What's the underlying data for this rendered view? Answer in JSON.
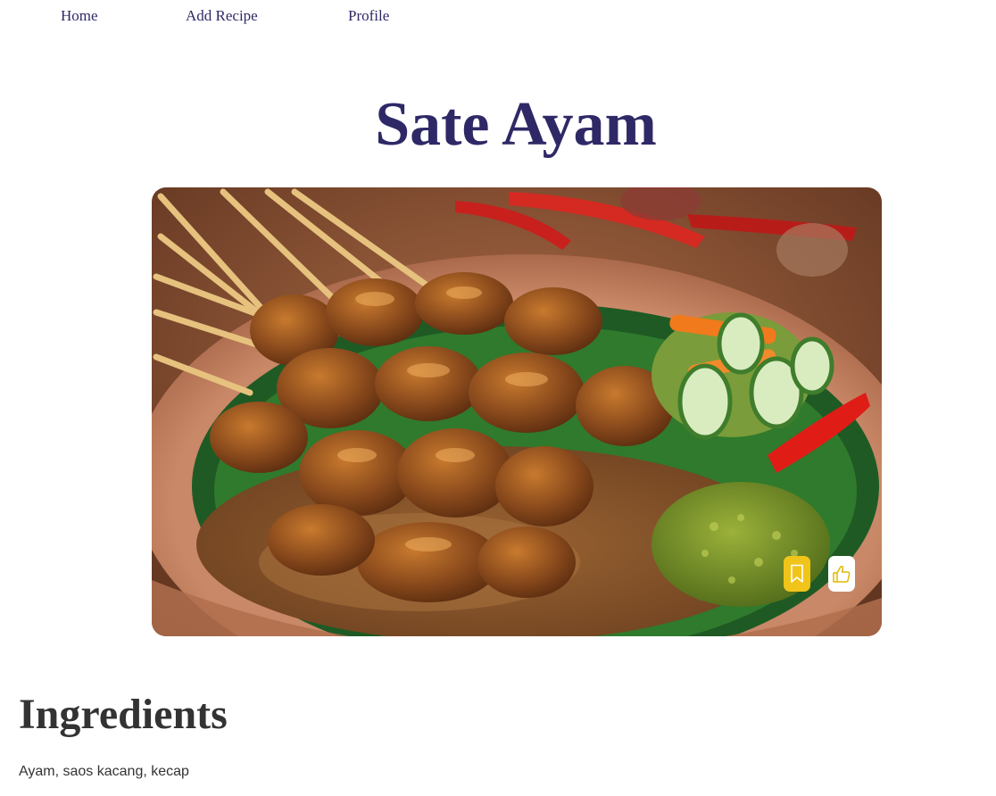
{
  "nav": {
    "items": [
      {
        "label": "Home"
      },
      {
        "label": "Add Recipe"
      },
      {
        "label": "Profile"
      }
    ]
  },
  "recipe": {
    "title": "Sate Ayam",
    "image_icon": "food-photo",
    "actions": {
      "bookmark_icon": "bookmark-icon",
      "like_icon": "thumbs-up-icon",
      "accent_color": "#f0c419"
    }
  },
  "ingredients": {
    "heading": "Ingredients",
    "text": "Ayam, saos kacang, kecap"
  },
  "colors": {
    "title": "#2e2966",
    "body_text": "#333333",
    "accent": "#f0c419"
  }
}
